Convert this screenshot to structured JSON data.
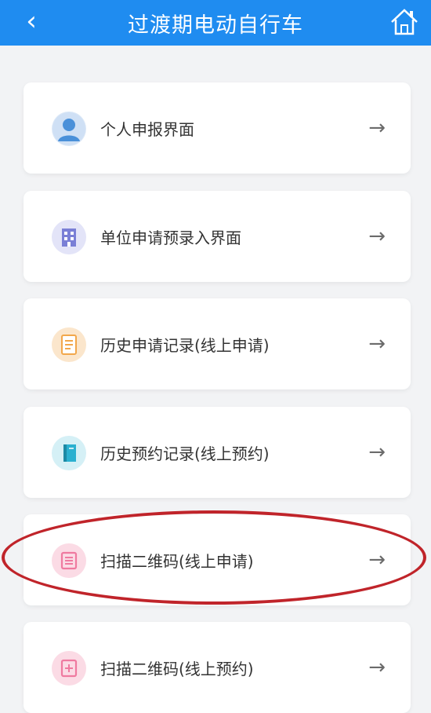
{
  "header": {
    "title": "过渡期电动自行车",
    "back_icon": "chevron-left-icon",
    "home_icon": "home-icon",
    "color": "#1f8cf0"
  },
  "menu": {
    "items": [
      {
        "label": "个人申报界面",
        "icon": "person-avatar-icon",
        "icon_color": "#4a90d9"
      },
      {
        "label": "单位申请预录入界面",
        "icon": "building-icon",
        "icon_color": "#7a7fd6"
      },
      {
        "label": "历史申请记录(线上申请)",
        "icon": "document-icon",
        "icon_color": "#f2a74b"
      },
      {
        "label": "历史预约记录(线上预约)",
        "icon": "book-icon",
        "icon_color": "#2ab0d0"
      },
      {
        "label": "扫描二维码(线上申请)",
        "icon": "qr-scan-icon",
        "icon_color": "#ef7aa0"
      },
      {
        "label": "扫描二维码(线上预约)",
        "icon": "qr-scan-icon",
        "icon_color": "#ef7aa0"
      }
    ],
    "arrow_icon": "arrow-right-icon"
  },
  "annotation": {
    "highlight_color": "#c0242a",
    "highlighted_item_index": 4
  }
}
